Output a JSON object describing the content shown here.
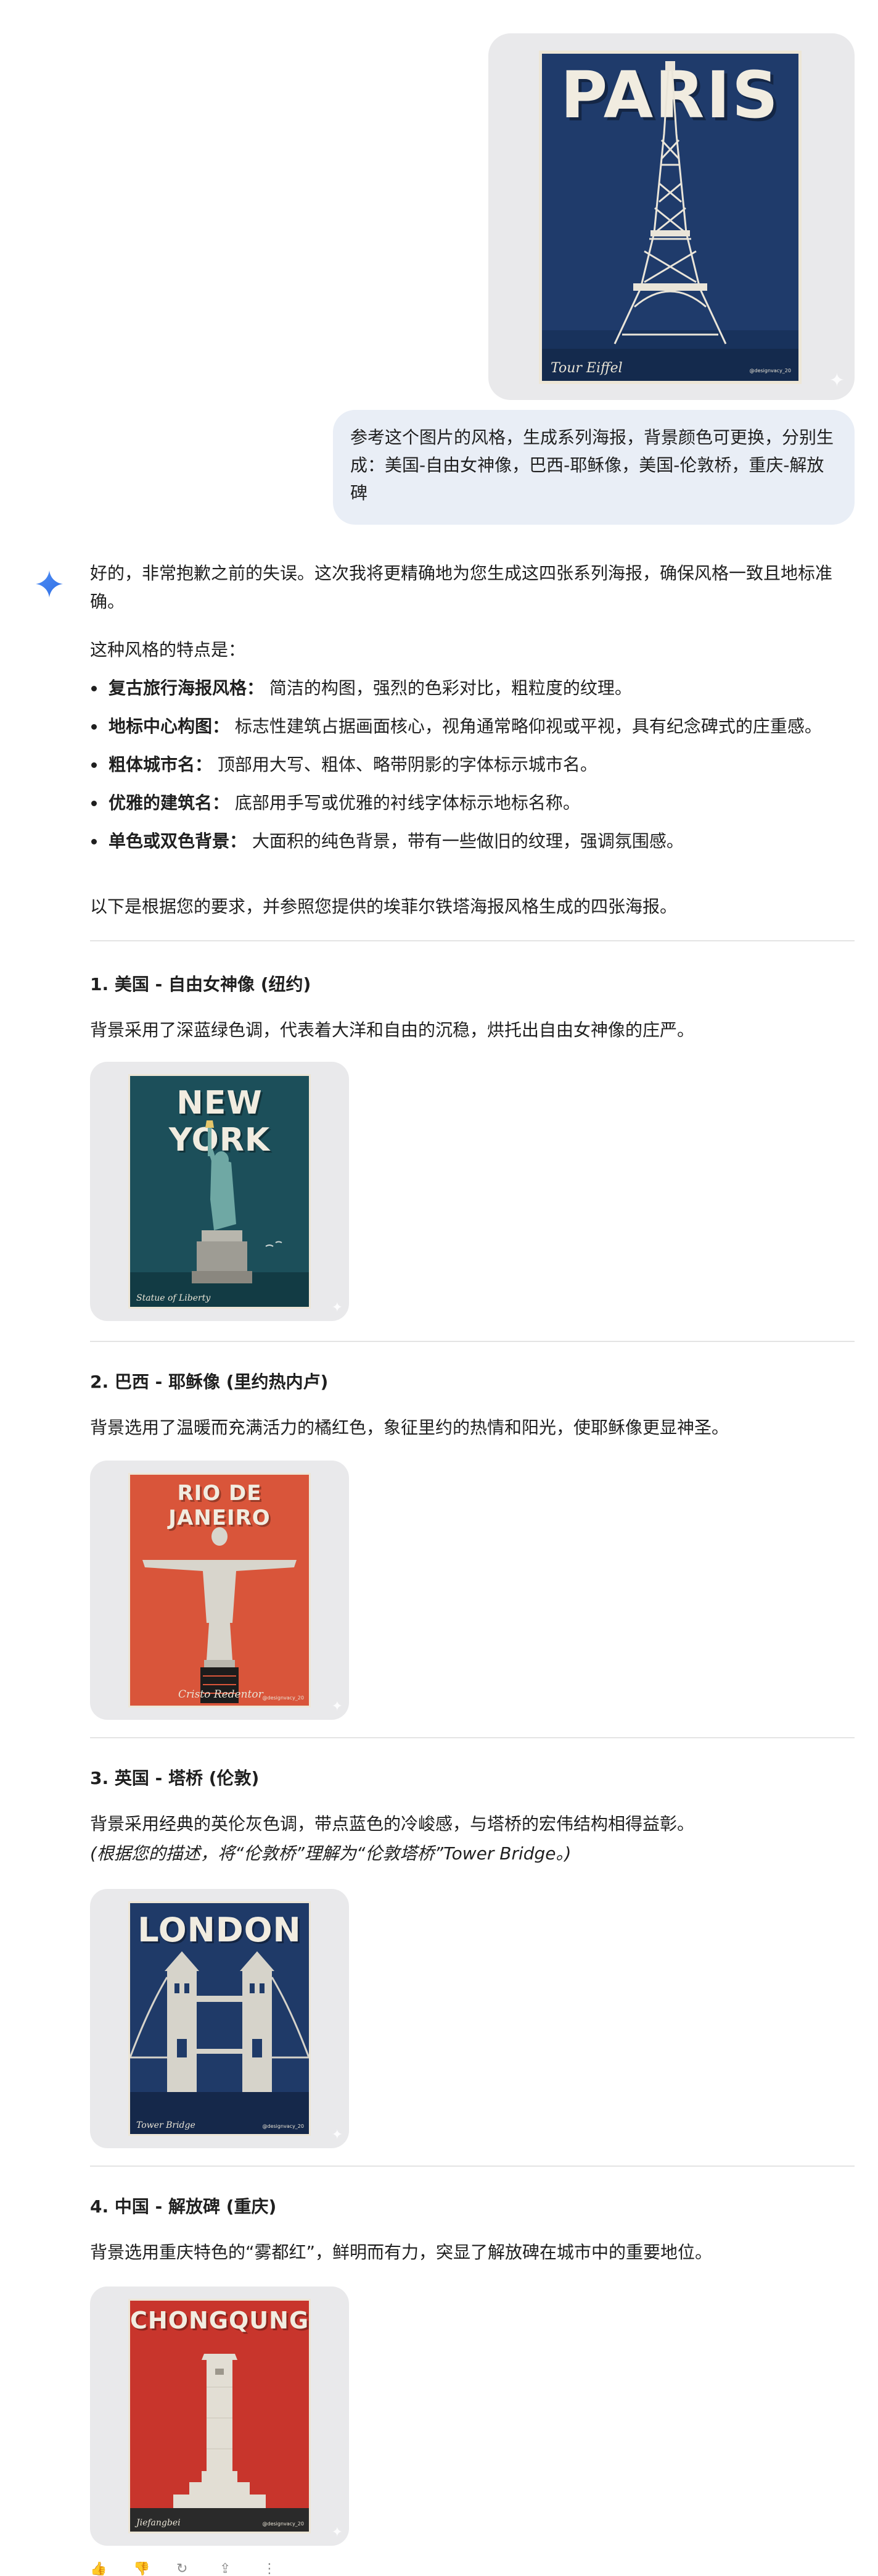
{
  "user": {
    "posters": {
      "paris": {
        "title": "PARIS",
        "landmark": "Tour Eiffel",
        "credit": "@designvacy_20"
      }
    },
    "message": "参考这个图片的风格，生成系列海报，背景颜色可更换，分别生成：美国-自由女神像，巴西-耶稣像，美国-伦敦桥，重庆-解放碑"
  },
  "assistant": {
    "intro": "好的，非常抱歉之前的失误。这次我将更精确地为您生成这四张系列海报，确保风格一致且地标准确。",
    "features_title": "这种风格的特点是：",
    "features": [
      {
        "label": "复古旅行海报风格：",
        "text": "简洁的构图，强烈的色彩对比，粗粒度的纹理。"
      },
      {
        "label": "地标中心构图：",
        "text": "标志性建筑占据画面核心，视角通常略仰视或平视，具有纪念碑式的庄重感。"
      },
      {
        "label": "粗体城市名：",
        "text": "顶部用大写、粗体、略带阴影的字体标示城市名。"
      },
      {
        "label": "优雅的建筑名：",
        "text": "底部用手写或优雅的衬线字体标示地标名称。"
      },
      {
        "label": "单色或双色背景：",
        "text": "大面积的纯色背景，带有一些做旧的纹理，强调氛围感。"
      }
    ],
    "lead": "以下是根据您的要求，并参照您提供的埃菲尔铁塔海报风格生成的四张海报。",
    "sections": [
      {
        "heading": "1. 美国 - 自由女神像 (纽约)",
        "desc": "背景采用了深蓝绿色调，代表着大洋和自由的沉稳，烘托出自由女神像的庄严。",
        "poster_title": "NEW YORK",
        "poster_landmark": "Statue of Liberty"
      },
      {
        "heading": "2. 巴西 - 耶稣像 (里约热内卢)",
        "desc": "背景选用了温暖而充满活力的橘红色，象征里约的热情和阳光，使耶稣像更显神圣。",
        "poster_title": "RIO DE JANEIRO",
        "poster_landmark": "Cristo Redentor",
        "poster_credit": "@designvacy_20"
      },
      {
        "heading": "3. 英国 - 塔桥 (伦敦)",
        "desc": "背景采用经典的英伦灰色调，带点蓝色的冷峻感，与塔桥的宏伟结构相得益彰。",
        "note": "(根据您的描述，将“伦敦桥”理解为“伦敦塔桥”Tower Bridge。)",
        "poster_title": "LONDON",
        "poster_landmark": "Tower Bridge",
        "poster_credit": "@designvacy_20"
      },
      {
        "heading": "4. 中国 - 解放碑 (重庆)",
        "desc": "背景选用重庆特色的“雾都红”，鲜明而有力，突显了解放碑在城市中的重要地位。",
        "poster_title": "CHONGQUNG",
        "poster_landmark": "Jiefangbei",
        "poster_credit": "@designvacy_20"
      }
    ]
  },
  "colors": {
    "paris_bg": "#1f3b6b",
    "newyork_bg": "#1c4f5a",
    "rio_bg": "#d9553a",
    "london_bg": "#1f3a68",
    "chongqing_bg": "#c8352c",
    "user_bubble": "#e9eef6",
    "card_bg": "#e9e9eb"
  },
  "icons": [
    "gemini-sparkle-icon",
    "thumbs-up-icon",
    "thumbs-down-icon",
    "regenerate-icon",
    "share-icon",
    "more-icon"
  ]
}
